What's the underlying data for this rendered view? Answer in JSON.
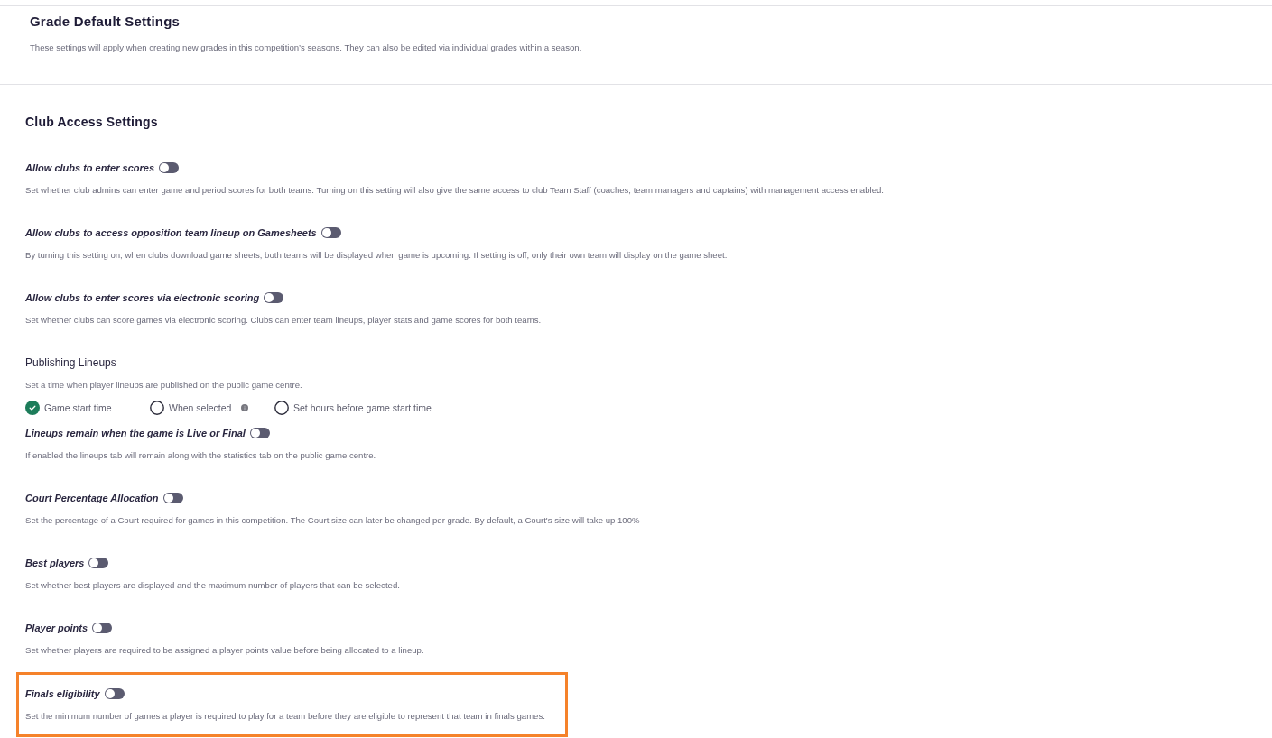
{
  "grade_defaults": {
    "title": "Grade Default Settings",
    "description": "These settings will apply when creating new grades in this competition’s seasons. They can also be edited via individual grades within a season."
  },
  "club_access": {
    "title": "Club Access Settings",
    "settings": [
      {
        "kind": "toggle",
        "label": "Allow clubs to enter scores",
        "on": false,
        "highlighted": false,
        "description": "Set whether club admins can enter game and period scores for both teams. Turning on this setting will also give the same access to club Team Staff (coaches, team managers and captains) with management access enabled."
      },
      {
        "kind": "toggle",
        "label": "Allow clubs to access opposition team lineup on Gamesheets",
        "on": false,
        "highlighted": false,
        "description": "By turning this setting on, when clubs download game sheets, both teams will be displayed when game is upcoming. If setting is off, only their own team will display on the game sheet."
      },
      {
        "kind": "toggle",
        "label": "Allow clubs to enter scores via electronic scoring",
        "on": false,
        "highlighted": false,
        "description": "Set whether clubs can score games via electronic scoring. Clubs can enter team lineups, player stats and game scores for both teams."
      },
      {
        "kind": "radio_group",
        "label": "Publishing Lineups",
        "description": "Set a time when player lineups are published on the public game centre.",
        "options": [
          {
            "label": "Game start time",
            "selected": true,
            "info": false
          },
          {
            "label": "When selected",
            "selected": false,
            "info": true
          },
          {
            "label": "Set hours before game start time",
            "selected": false,
            "info": false
          }
        ]
      },
      {
        "kind": "toggle",
        "label": "Lineups remain when the game is Live or Final",
        "on": false,
        "highlighted": false,
        "description": "If enabled the lineups tab will remain along with the statistics tab on the public game centre."
      },
      {
        "kind": "toggle",
        "label": "Court Percentage Allocation",
        "on": false,
        "highlighted": false,
        "description": "Set the percentage of a Court required for games in this competition. The Court size can later be changed per grade. By default, a Court's size will take up 100%"
      },
      {
        "kind": "toggle",
        "label": "Best players",
        "on": false,
        "highlighted": false,
        "description": "Set whether best players are displayed and the maximum number of players that can be selected."
      },
      {
        "kind": "toggle",
        "label": "Player points",
        "on": false,
        "highlighted": false,
        "description": "Set whether players are required to be assigned a player points value before being allocated to a lineup."
      },
      {
        "kind": "toggle",
        "label": "Finals eligibility",
        "on": false,
        "highlighted": true,
        "description": "Set the minimum number of games a player is required to play for a team before they are eligible to represent that team in finals games."
      }
    ]
  }
}
